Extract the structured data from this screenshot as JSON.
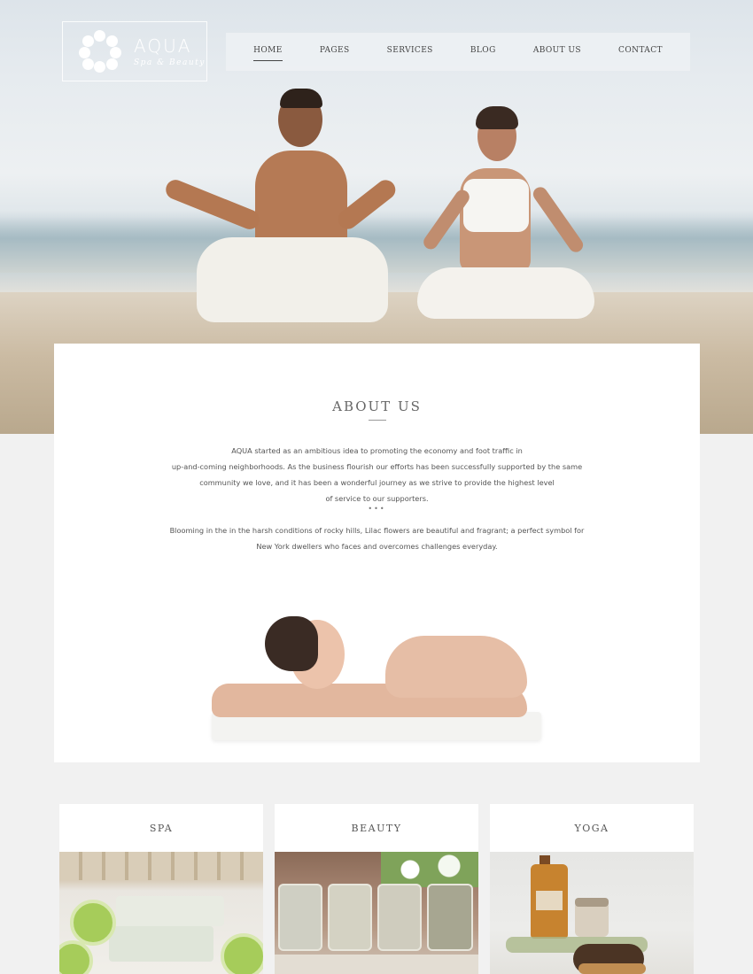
{
  "logo": {
    "name": "AQUA",
    "tagline": "Spa & Beauty"
  },
  "nav": {
    "items": [
      {
        "label": "HOME",
        "active": true
      },
      {
        "label": "PAGES",
        "active": false
      },
      {
        "label": "SERVICES",
        "active": false
      },
      {
        "label": "BLOG",
        "active": false
      },
      {
        "label": "ABOUT US",
        "active": false
      },
      {
        "label": "CONTACT",
        "active": false
      }
    ]
  },
  "about": {
    "heading": "ABOUT US",
    "paragraph1_lines": [
      "AQUA started as an ambitious idea to promoting the economy and foot traffic in",
      "up-and-coming neighborhoods. As the business flourish our efforts has been successfully supported by the same",
      "community we love, and it has been a wonderful journey as we strive to provide the highest level",
      "of service to our supporters."
    ],
    "separator": "•••",
    "paragraph2_lines": [
      "Blooming in the in the harsh conditions of rocky hills, Lilac flowers are beautiful and fragrant; a perfect symbol for",
      "New York dwellers who faces and overcomes challenges everyday."
    ]
  },
  "cards": [
    {
      "title": "SPA"
    },
    {
      "title": "BEAUTY"
    },
    {
      "title": "YOGA"
    }
  ],
  "colors": {
    "background": "#f1f1f1",
    "card": "#ffffff",
    "nav_bg": "#eef2f4",
    "text": "#555555"
  }
}
